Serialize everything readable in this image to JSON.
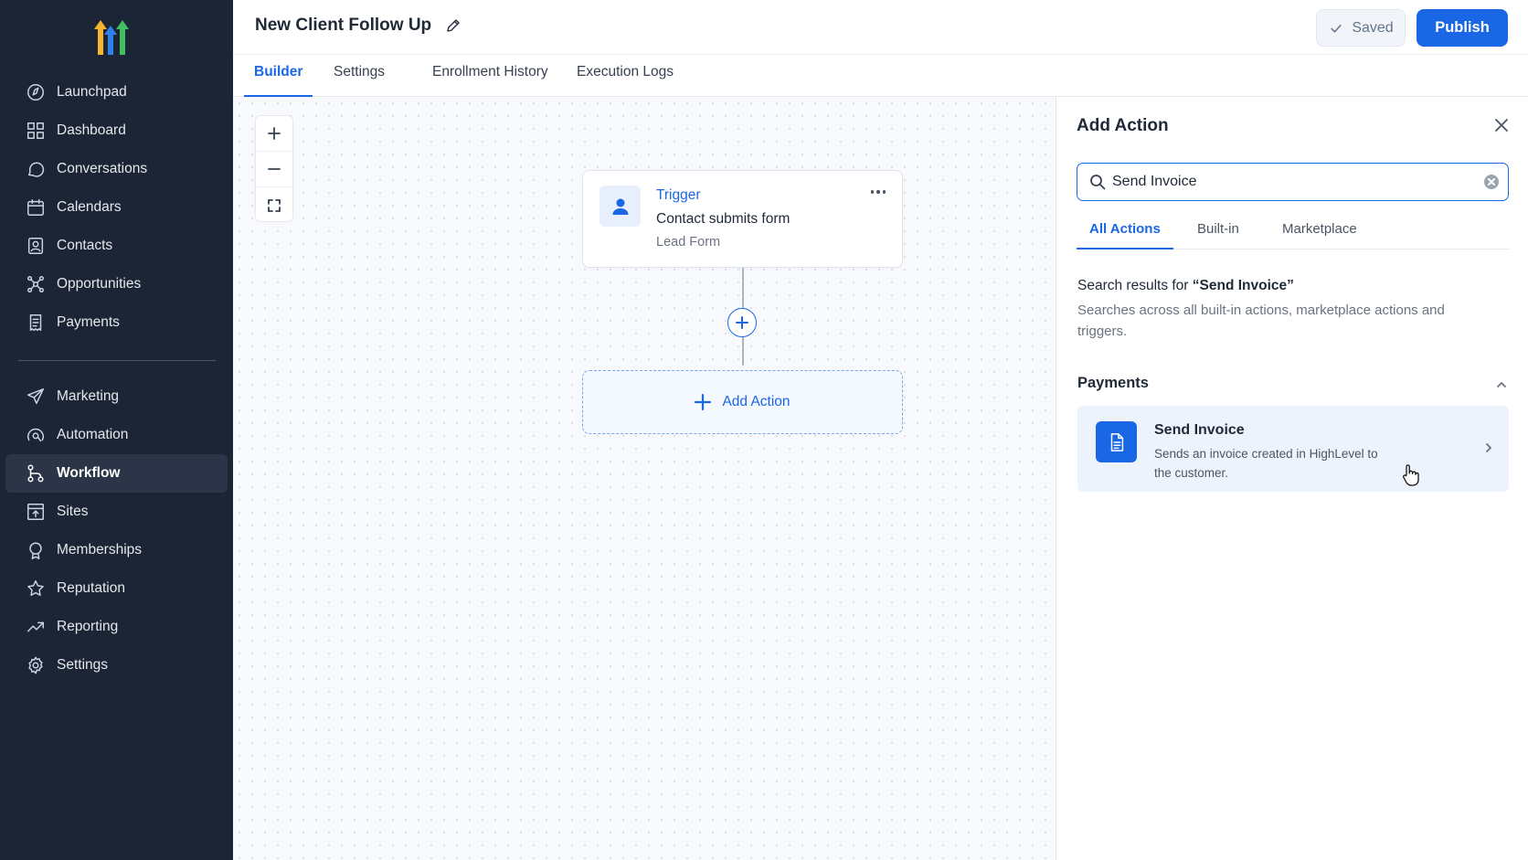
{
  "sidebar": {
    "items": [
      {
        "label": "Launchpad",
        "icon": "launchpad-icon"
      },
      {
        "label": "Dashboard",
        "icon": "dashboard-icon"
      },
      {
        "label": "Conversations",
        "icon": "chat-icon"
      },
      {
        "label": "Calendars",
        "icon": "calendar-icon"
      },
      {
        "label": "Contacts",
        "icon": "contacts-icon"
      },
      {
        "label": "Opportunities",
        "icon": "opportunities-icon"
      },
      {
        "label": "Payments",
        "icon": "payments-icon"
      },
      {
        "label": "Marketing",
        "icon": "send-icon"
      },
      {
        "label": "Automation",
        "icon": "automation-icon"
      },
      {
        "label": "Workflow",
        "icon": "workflow-icon",
        "active": true
      },
      {
        "label": "Sites",
        "icon": "sites-icon"
      },
      {
        "label": "Memberships",
        "icon": "memberships-icon"
      },
      {
        "label": "Reputation",
        "icon": "star-icon"
      },
      {
        "label": "Reporting",
        "icon": "trend-icon"
      },
      {
        "label": "Settings",
        "icon": "gear-icon"
      }
    ]
  },
  "header": {
    "title": "New Client Follow Up",
    "saved_label": "Saved",
    "publish_label": "Publish"
  },
  "tabs": [
    {
      "label": "Builder",
      "active": true
    },
    {
      "label": "Settings"
    },
    {
      "label": "Enrollment History"
    },
    {
      "label": "Execution Logs"
    }
  ],
  "canvas": {
    "trigger": {
      "label": "Trigger",
      "event": "Contact submits form",
      "detail": "Lead Form"
    },
    "add_action_label": "Add Action"
  },
  "panel": {
    "title": "Add Action",
    "search": {
      "value": "Send Invoice"
    },
    "tabs": [
      {
        "label": "All Actions",
        "active": true
      },
      {
        "label": "Built-in"
      },
      {
        "label": "Marketplace"
      }
    ],
    "results_prefix": "Search results for ",
    "results_query": "“Send Invoice”",
    "results_desc": "Searches across all built-in actions, marketplace actions and triggers.",
    "section": "Payments",
    "result": {
      "name": "Send Invoice",
      "description": "Sends an invoice created in HighLevel to the customer."
    }
  },
  "colors": {
    "sidebar_bg": "#1c2536",
    "accent": "#1a67e6",
    "card_highlight": "#edf3fd"
  }
}
